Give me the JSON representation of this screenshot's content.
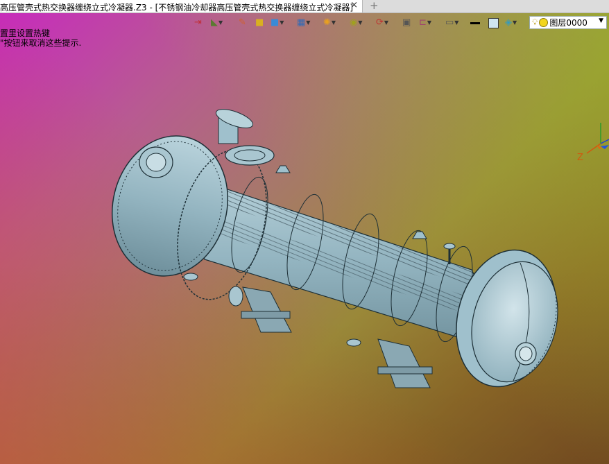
{
  "tab": {
    "title": "高压管壳式热交换器缠绕立式冷凝器.Z3 - [不锈钢油冷却器高压管壳式热交换器缠绕立式冷凝器]",
    "close_icon": "×",
    "new_tab_icon": "+"
  },
  "hint": {
    "line1": "置里设置热键",
    "line2": "\"按钮来取消这些提示."
  },
  "toolbar": {
    "icons": [
      "exit-icon",
      "paint-icon",
      "pencil-icon",
      "cube-yellow-icon",
      "cube-blue-icon",
      "cube-multi-icon",
      "render-icon",
      "zoom-icon",
      "rotate-icon",
      "frame-icon",
      "section-icon",
      "display-icon",
      "line-color-icon",
      "fill-icon",
      "layer-stack-icon"
    ]
  },
  "layer": {
    "name": "图层0000",
    "bulb_icon": "lightbulb-icon",
    "status_icon": "yellow-circle-icon"
  },
  "axis": {
    "z_label": "Z"
  },
  "colors": {
    "tab_bg": "#ffffff",
    "model_fill": "#9fc0cc",
    "model_edge": "#1d2f36"
  }
}
